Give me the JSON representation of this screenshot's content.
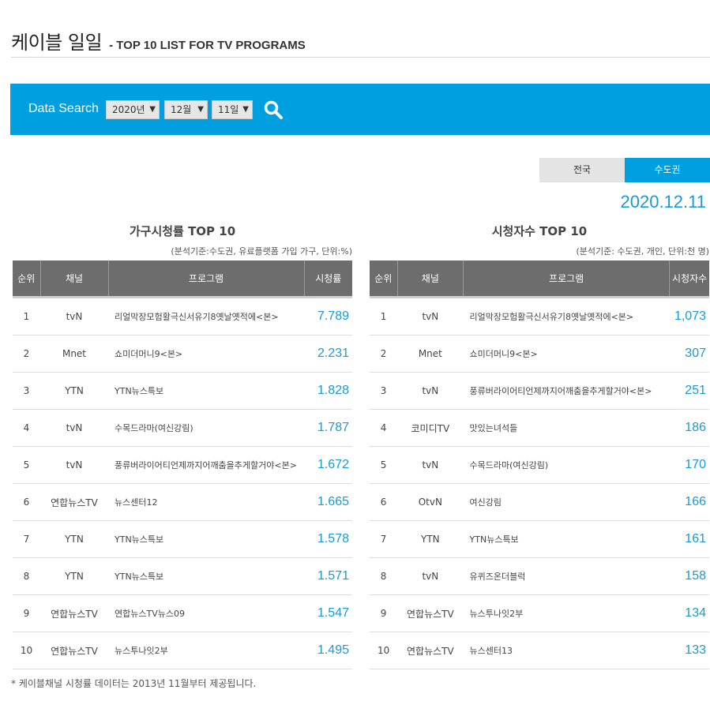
{
  "header": {
    "title": "케이블 일일",
    "subtitle": "- TOP 10 LIST FOR TV PROGRAMS"
  },
  "search": {
    "label": "Data Search",
    "year": "2020년",
    "month": "12월",
    "day": "11일",
    "icon": "search-icon"
  },
  "region_tabs": {
    "national": "전국",
    "capital": "수도권",
    "active": "수도권"
  },
  "date": "2020.12.11",
  "colors": {
    "accent": "#009fe0",
    "value": "#1a9ad6",
    "header_bg": "#6d6d6d"
  },
  "household": {
    "title": "가구시청률 TOP 10",
    "note": "(분석기준:수도권, 유료플랫폼 가입 가구, 단위:%)",
    "columns": [
      "순위",
      "채널",
      "프로그램",
      "시청률"
    ],
    "rows": [
      {
        "rank": "1",
        "channel": "tvN",
        "program": "리얼막장모험활극신서유기8옛날옛적에<본>",
        "value": "7.789"
      },
      {
        "rank": "2",
        "channel": "Mnet",
        "program": "쇼미더머니9<본>",
        "value": "2.231"
      },
      {
        "rank": "3",
        "channel": "YTN",
        "program": "YTN뉴스특보",
        "value": "1.828"
      },
      {
        "rank": "4",
        "channel": "tvN",
        "program": "수목드라마(여신강림)",
        "value": "1.787"
      },
      {
        "rank": "5",
        "channel": "tvN",
        "program": "풍류버라이어티언제까지어깨춤을추게할거야<본>",
        "value": "1.672"
      },
      {
        "rank": "6",
        "channel": "연합뉴스TV",
        "program": "뉴스센터12",
        "value": "1.665"
      },
      {
        "rank": "7",
        "channel": "YTN",
        "program": "YTN뉴스특보",
        "value": "1.578"
      },
      {
        "rank": "8",
        "channel": "YTN",
        "program": "YTN뉴스특보",
        "value": "1.571"
      },
      {
        "rank": "9",
        "channel": "연합뉴스TV",
        "program": "연합뉴스TV뉴스09",
        "value": "1.547"
      },
      {
        "rank": "10",
        "channel": "연합뉴스TV",
        "program": "뉴스투나잇2부",
        "value": "1.495"
      }
    ]
  },
  "viewers": {
    "title": "시청자수 TOP 10",
    "note": "(분석기준: 수도권, 개인, 단위:천 명)",
    "columns": [
      "순위",
      "채널",
      "프로그램",
      "시청자수"
    ],
    "rows": [
      {
        "rank": "1",
        "channel": "tvN",
        "program": "리얼막장모험활극신서유기8옛날옛적에<본>",
        "value": "1,073"
      },
      {
        "rank": "2",
        "channel": "Mnet",
        "program": "쇼미더머니9<본>",
        "value": "307"
      },
      {
        "rank": "3",
        "channel": "tvN",
        "program": "풍류버라이어티언제까지어깨춤을추게할거야<본>",
        "value": "251"
      },
      {
        "rank": "4",
        "channel": "코미디TV",
        "program": "맛있는녀석들",
        "value": "186"
      },
      {
        "rank": "5",
        "channel": "tvN",
        "program": "수목드라마(여신강림)",
        "value": "170"
      },
      {
        "rank": "6",
        "channel": "OtvN",
        "program": "여신강림",
        "value": "166"
      },
      {
        "rank": "7",
        "channel": "YTN",
        "program": "YTN뉴스특보",
        "value": "161"
      },
      {
        "rank": "8",
        "channel": "tvN",
        "program": "유퀴즈온더블럭",
        "value": "158"
      },
      {
        "rank": "9",
        "channel": "연합뉴스TV",
        "program": "뉴스투나잇2부",
        "value": "134"
      },
      {
        "rank": "10",
        "channel": "연합뉴스TV",
        "program": "뉴스센터13",
        "value": "133"
      }
    ]
  },
  "footnote": "* 케이블채널 시청률 데이터는 2013년 11월부터 제공됩니다."
}
